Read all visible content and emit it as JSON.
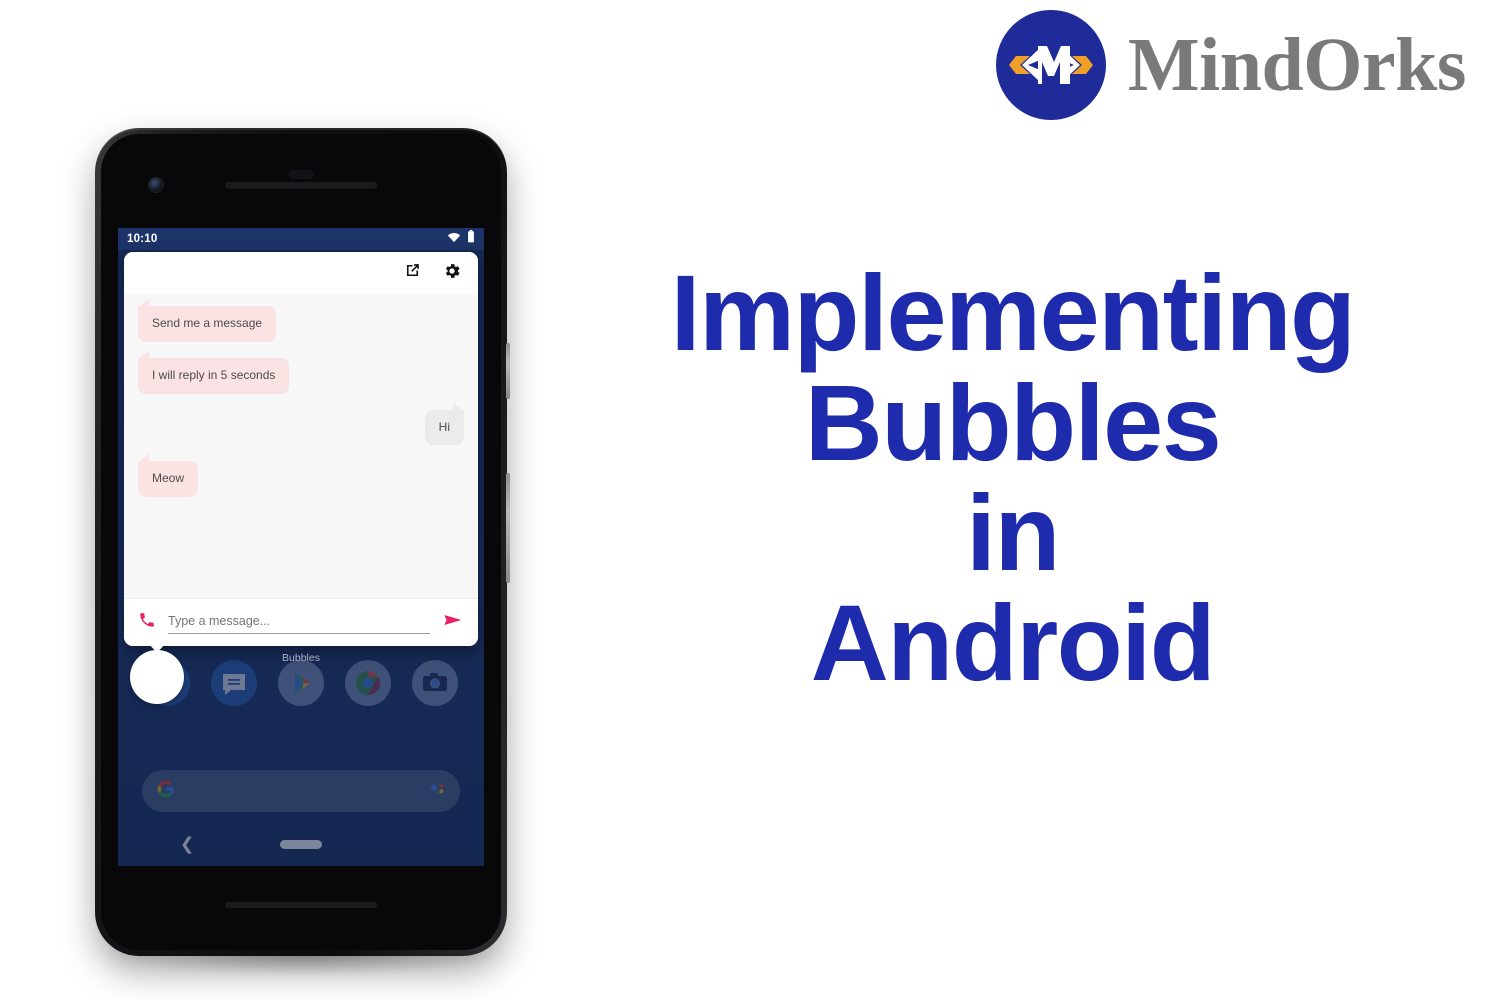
{
  "brand": {
    "name": "MindOrks",
    "logo_icon": "mindorks-chevron-m-logo",
    "colors": {
      "circle": "#1f2b98",
      "chevron_orange": "#f0a028",
      "wordmark": "#7a7a7a"
    }
  },
  "headline": {
    "color": "#1f2bad",
    "lines": [
      "Implementing",
      "Bubbles",
      "in",
      "Android"
    ]
  },
  "phone": {
    "device": "pixel-phone-mockup",
    "status_bar": {
      "time": "10:10",
      "icons": [
        "wifi-icon",
        "battery-icon"
      ],
      "background": "#1d3468"
    },
    "chat_panel": {
      "header_icons": [
        "open-in-new-icon",
        "settings-gear-icon"
      ],
      "messages": [
        {
          "text": "Send me a message",
          "side": "in"
        },
        {
          "text": "I will reply in 5 seconds",
          "side": "in"
        },
        {
          "text": "Hi",
          "side": "out"
        },
        {
          "text": "Meow",
          "side": "in"
        }
      ],
      "input": {
        "placeholder": "Type a message...",
        "value": "",
        "left_icon": "phone-call-icon",
        "send_icon": "send-arrow-icon",
        "accent": "#e91e63"
      }
    },
    "bubble": {
      "label": "Bubbles",
      "avatar_icon": "chat-bubble-avatar"
    },
    "launcher": {
      "dock_apps": [
        {
          "name": "phone-app-icon"
        },
        {
          "name": "messages-app-icon"
        },
        {
          "name": "play-store-app-icon"
        },
        {
          "name": "chrome-app-icon"
        },
        {
          "name": "camera-app-icon"
        }
      ],
      "search_bar": {
        "left_icon": "google-g-icon",
        "right_icon": "google-assistant-icon",
        "query": ""
      },
      "nav": {
        "back_icon": "back-chevron-icon",
        "home_pill": "gesture-home-pill"
      },
      "wallpaper_color": "#1e3464"
    }
  }
}
